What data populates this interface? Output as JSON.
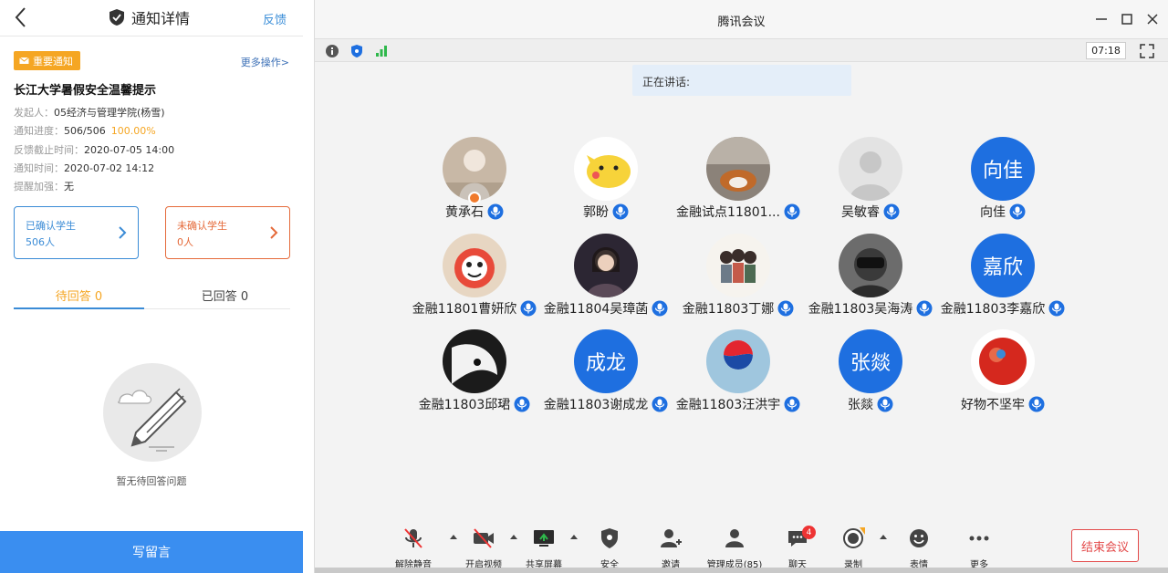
{
  "left_panel": {
    "header": {
      "title": "通知详情",
      "feedback": "反馈"
    },
    "badge": "重要通知",
    "more_actions": "更多操作>",
    "notice_title": "长江大学暑假安全温馨提示",
    "meta": [
      {
        "label": "发起人：",
        "value": "05经济与管理学院(杨雪)"
      },
      {
        "label": "通知进度：",
        "value": "506/506",
        "extra": "100.00%"
      },
      {
        "label": "反馈截止时间：",
        "value": "2020-07-05 14:00"
      },
      {
        "label": "通知时间：",
        "value": "2020-07-02 14:12"
      },
      {
        "label": "提醒加强：",
        "value": "无"
      }
    ],
    "cards": {
      "confirmed": {
        "title": "已确认学生",
        "count": "506人"
      },
      "unconfirmed": {
        "title": "未确认学生",
        "count": "0人"
      }
    },
    "tabs": {
      "pending": "待回答 0",
      "answered": "已回答 0"
    },
    "empty_text": "暂无待回答问题",
    "write_button": "写留言"
  },
  "meeting": {
    "title": "腾讯会议",
    "timer": "07:18",
    "speaking_label": "正在讲话:",
    "participants": [
      {
        "name": "黄承石",
        "avatar": "photo-child",
        "host": true
      },
      {
        "name": "郭盼",
        "avatar": "cartoon-pikachu"
      },
      {
        "name": "金融试点11801...",
        "avatar": "photo-cat"
      },
      {
        "name": "吴敏睿",
        "avatar": "default-person"
      },
      {
        "name": "向佳",
        "avatar": "initials",
        "initials": "向佳"
      },
      {
        "name": "金融11801曹妍欣",
        "avatar": "cartoon-character"
      },
      {
        "name": "金融11804吴璋菡",
        "avatar": "photo-woman"
      },
      {
        "name": "金融11803丁娜",
        "avatar": "cartoon-group"
      },
      {
        "name": "金融11803吴海涛",
        "avatar": "photo-vr"
      },
      {
        "name": "金融11803李嘉欣",
        "avatar": "initials",
        "initials": "嘉欣"
      },
      {
        "name": "金融11803邱珺",
        "avatar": "anime-dark"
      },
      {
        "name": "金融11803谢成龙",
        "avatar": "initials",
        "initials": "成龙"
      },
      {
        "name": "金融11803汪洪宇",
        "avatar": "pepsi-logo"
      },
      {
        "name": "张燚",
        "avatar": "initials",
        "initials": "张燚"
      },
      {
        "name": "好物不坚牢",
        "avatar": "red-sphere"
      }
    ],
    "toolbar": {
      "unmute": "解除静音",
      "start_video": "开启视频",
      "share_screen": "共享屏幕",
      "security": "安全",
      "invite": "邀请",
      "members": "管理成员(85)",
      "chat": "聊天",
      "chat_badge": "4",
      "record": "录制",
      "reaction": "表情",
      "more": "更多",
      "end_meeting": "结束会议"
    }
  },
  "colors": {
    "accent_blue": "#3a8ef0",
    "warning_orange": "#f5a623",
    "danger": "#e34a4a",
    "avatar_blue": "#1e6fe0"
  }
}
